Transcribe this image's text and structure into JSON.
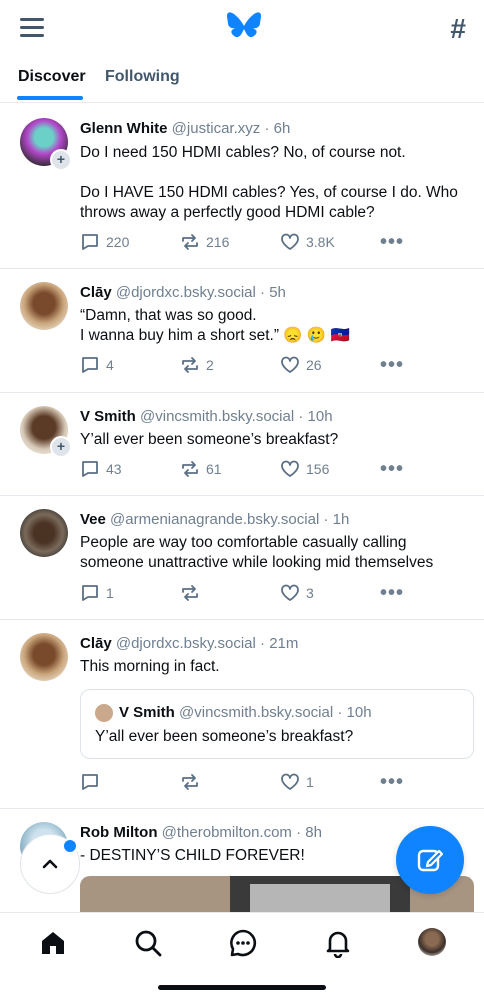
{
  "header": {
    "logo_icon": "butterfly-icon",
    "menu_icon": "hamburger-icon",
    "feeds_icon": "hash-icon",
    "feeds_label": "#",
    "accent": "#1083fe"
  },
  "tabs": [
    {
      "label": "Discover",
      "active": true
    },
    {
      "label": "Following",
      "active": false
    }
  ],
  "posts": [
    {
      "name": "Glenn White",
      "handle": "@justicar.xyz",
      "sep": "·",
      "time": "6h",
      "text": "Do I need 150 HDMI cables? No, of course not.\n\nDo I HAVE 150 HDMI cables? Yes, of course I do. Who throws away a perfectly good HDMI cable?",
      "replies": "220",
      "reposts": "216",
      "likes": "3.8K",
      "can_follow": true
    },
    {
      "name": "Clāy",
      "handle": "@djordxc.bsky.social",
      "sep": "·",
      "time": "5h",
      "text": "“Damn, that was so good.\nI wanna buy him a short set.” 😞 🥲 🇭🇹",
      "replies": "4",
      "reposts": "2",
      "likes": "26",
      "can_follow": false
    },
    {
      "name": "V Smith",
      "handle": "@vincsmith.bsky.social",
      "sep": "·",
      "time": "10h",
      "text": "Y’all ever been someone’s breakfast?",
      "replies": "43",
      "reposts": "61",
      "likes": "156",
      "can_follow": true
    },
    {
      "name": "Vee",
      "handle": "@armenianagrande.bsky.social",
      "sep": "·",
      "time": "1h",
      "text": "People are way too comfortable casually calling someone unattractive while looking mid themselves",
      "replies": "1",
      "reposts": "",
      "likes": "3",
      "can_follow": false
    },
    {
      "name": "Clāy",
      "handle": "@djordxc.bsky.social",
      "sep": "·",
      "time": "21m",
      "text": "This morning in fact.",
      "replies": "",
      "reposts": "",
      "likes": "1",
      "can_follow": false,
      "quote": {
        "name": "V Smith",
        "handle": "@vincsmith.bsky.social",
        "sep": "·",
        "time": "10h",
        "text": "Y’all ever been someone’s breakfast?"
      }
    },
    {
      "name": "Rob Milton",
      "handle": "@therobmilton.com",
      "sep": "·",
      "time": "8h",
      "text": "- DESTINY’S CHILD FOREVER!",
      "can_follow": false
    }
  ],
  "more_glyph": "•••",
  "floating": {
    "scroll_top_icon": "chevron-up-icon",
    "compose_icon": "compose-icon"
  },
  "bottom_nav": [
    "home-icon",
    "search-icon",
    "chat-icon",
    "bell-icon",
    "profile-avatar"
  ]
}
